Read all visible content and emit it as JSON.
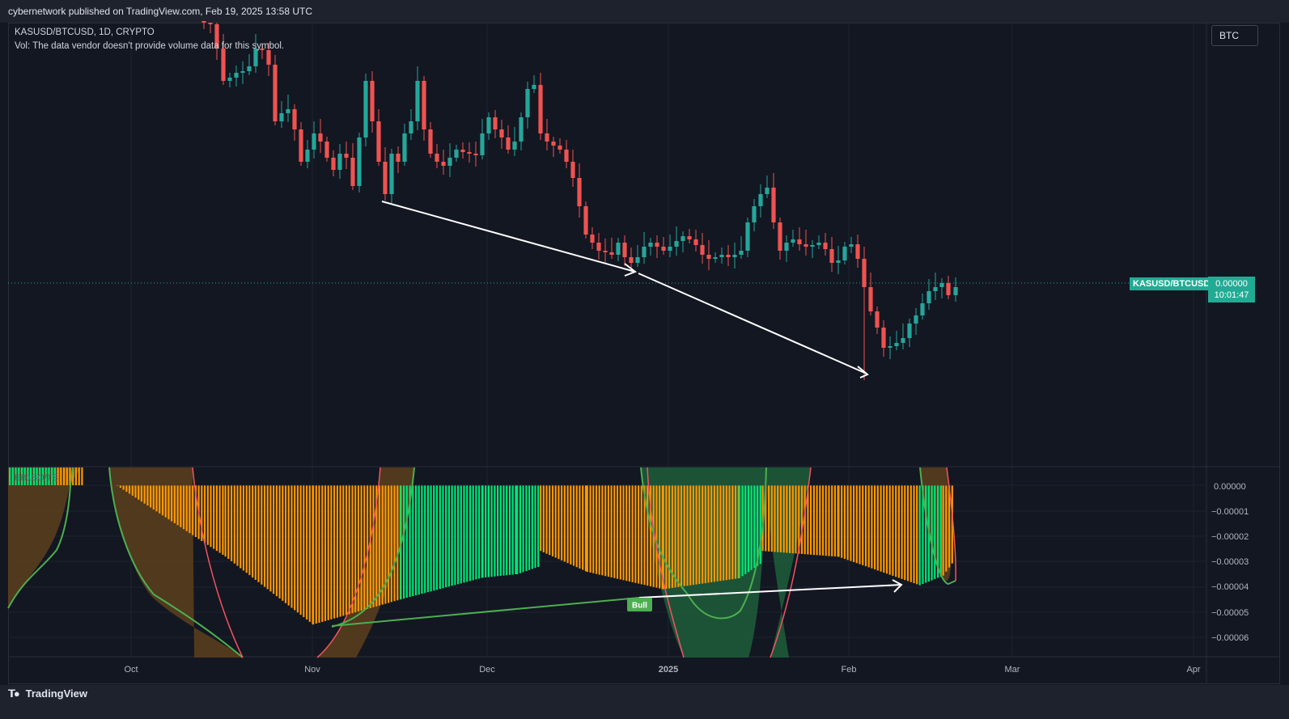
{
  "header": {
    "published": "cybernetwork published on TradingView.com, Feb 19, 2025 13:58 UTC"
  },
  "legend": {
    "symbol_line": "KASUSD/BTCUSD, 1D, CRYPTO",
    "volume_line": "Vol: The data vendor doesn't provide volume data for this symbol."
  },
  "symbol_button": "BTC",
  "price_label": {
    "symbol": "KASUSD/BTCUSD",
    "price": "0.00000",
    "countdown": "10:01:47"
  },
  "indicator_label": "EB1SO/TS",
  "bull_label": "Bull",
  "footer": {
    "brand": "TradingView"
  },
  "colors": {
    "up": "#26a69a",
    "down": "#ef5350",
    "hist_orange": "#ff9800",
    "hist_green": "#00e676",
    "background": "#131722"
  },
  "chart_data": [
    {
      "type": "candlestick",
      "title": "KASUSD/BTCUSD, 1D, CRYPTO",
      "x_tick_labels": [
        "Oct",
        "Nov",
        "Dec",
        "2025",
        "Feb",
        "Mar",
        "Apr"
      ],
      "annotations": [
        "downward arrow from early Nov low to late Dec low",
        "downward arrow from late Dec low to early Feb low"
      ]
    },
    {
      "type": "bar",
      "name": "EB1SO/TS",
      "y_tick_labels": [
        "0.00000",
        "−0.00001",
        "−0.00002",
        "−0.00003",
        "−0.00004",
        "−0.00005",
        "−0.00006"
      ],
      "ylim": [
        -6.8e-05,
        7.5e-06
      ],
      "note_labels": [
        "Bull"
      ],
      "histogram_segments": [
        {
          "x_from": "Sep 24",
          "x_to": "Oct 17",
          "start": -1e-07,
          "end": -2.82e-05,
          "color": "orange"
        },
        {
          "x_from": "Oct 17",
          "x_to": "Nov 1",
          "start": -2.82e-05,
          "end": -5.52e-05,
          "color": "orange"
        },
        {
          "x_from": "Nov 1",
          "x_to": "Nov 16",
          "start": -5.52e-05,
          "end": -4.52e-05,
          "color": "orange"
        },
        {
          "x_from": "Nov 16",
          "x_to": "Nov 30",
          "start": -4.52e-05,
          "end": -3.66e-05,
          "color": "green"
        },
        {
          "x_from": "Nov 30",
          "x_to": "Dec 6",
          "start": -3.66e-05,
          "end": -3.52e-05,
          "color": "green"
        },
        {
          "x_from": "Dec 6",
          "x_to": "Dec 10",
          "start": -3.52e-05,
          "end": -3.2e-05,
          "color": "green"
        },
        {
          "x_from": "Dec 10",
          "x_to": "Dec 18",
          "start": -2.6e-05,
          "end": -3.43e-05,
          "color": "orange"
        },
        {
          "x_from": "Dec 18",
          "x_to": "Dec 31",
          "start": -3.43e-05,
          "end": -4.12e-05,
          "color": "orange"
        },
        {
          "x_from": "Dec 31",
          "x_to": "Jan 13",
          "start": -4.12e-05,
          "end": -3.68e-05,
          "color": "orange"
        },
        {
          "x_from": "Jan 13",
          "x_to": "Jan 17",
          "start": -3.68e-05,
          "end": -3.05e-05,
          "color": "green"
        },
        {
          "x_from": "Jan 17",
          "x_to": "Jan 30",
          "start": -2.6e-05,
          "end": -2.83e-05,
          "color": "orange"
        },
        {
          "x_from": "Jan 30",
          "x_to": "Feb 13",
          "start": -2.83e-05,
          "end": -3.96e-05,
          "color": "orange"
        },
        {
          "x_from": "Feb 13",
          "x_to": "Feb 17",
          "start": -3.96e-05,
          "end": -3.58e-05,
          "color": "green"
        },
        {
          "x_from": "Feb 17",
          "x_to": "Feb 19",
          "start": -3.58e-05,
          "end": -2.95e-05,
          "color": "orange"
        }
      ]
    }
  ]
}
